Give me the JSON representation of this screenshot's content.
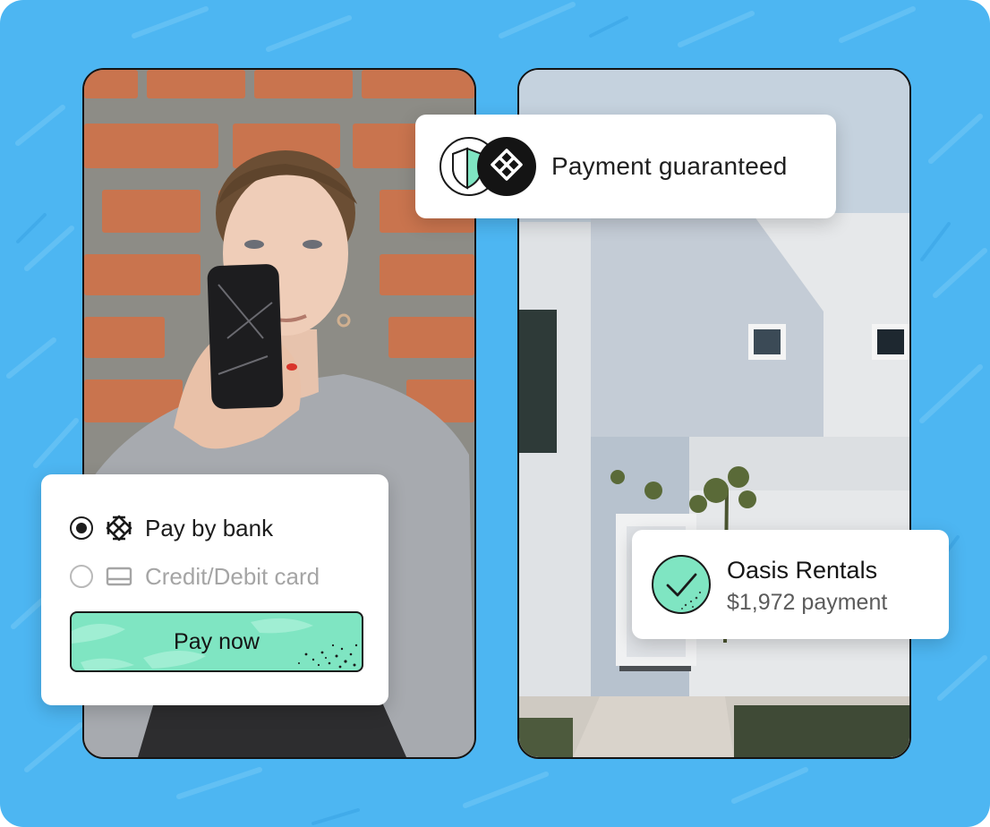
{
  "guarantee_card": {
    "text": "Payment guaranteed",
    "icons": [
      "shield-icon",
      "bank-logo-icon"
    ]
  },
  "payment_options": {
    "bank_label": "Pay by bank",
    "card_label": "Credit/Debit card",
    "selected": "bank",
    "bank_icon": "bank-logo-icon",
    "card_icon": "credit-card-icon"
  },
  "pay_button": {
    "label": "Pay now"
  },
  "merchant_card": {
    "name": "Oasis Rentals",
    "amount": "$1,972 payment",
    "icon": "checkmark-icon"
  },
  "colors": {
    "background": "#4db6f2",
    "accent_mint": "#7fe5c2",
    "dark": "#141414"
  }
}
